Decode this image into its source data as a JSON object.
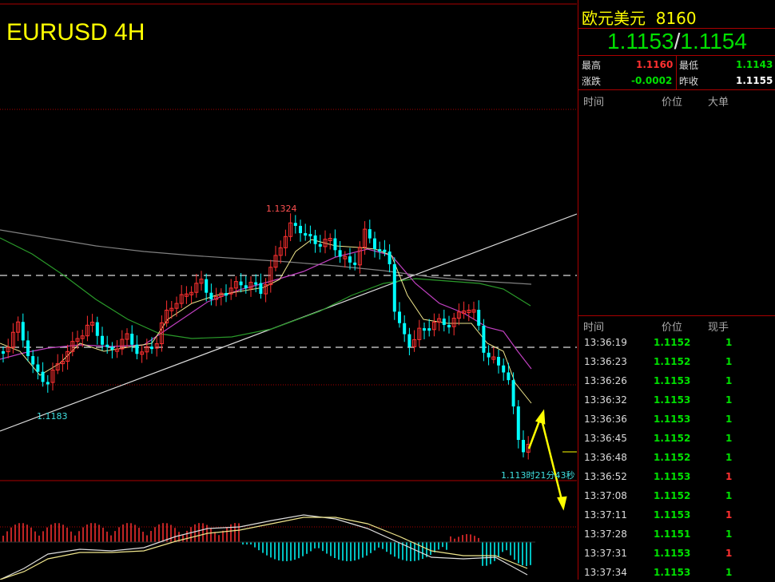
{
  "chart": {
    "symbol_title": "EURUSD 4H",
    "high_label": "1.1324",
    "low_label": "1.1183",
    "countdown_label": "1.113时21分43秒"
  },
  "quote": {
    "name": "欧元美元",
    "code": "8160",
    "bid": "1.1153",
    "separator": "/",
    "ask": "1.1154",
    "stats": {
      "high_label": "最高",
      "high_value": "1.1160",
      "low_label": "最低",
      "low_value": "1.1143",
      "change_label": "涨跌",
      "change_value": "-0.0002",
      "prev_close_label": "昨收",
      "prev_close_value": "1.1155"
    },
    "big_orders_header": {
      "time": "时间",
      "price": "价位",
      "big": "大单"
    },
    "ticks_header": {
      "time": "时间",
      "price": "价位",
      "volume": "现手"
    },
    "ticks": [
      {
        "time": "13:36:19",
        "price": "1.1152",
        "volume": "1",
        "up": true
      },
      {
        "time": "13:36:23",
        "price": "1.1152",
        "volume": "1",
        "up": true
      },
      {
        "time": "13:36:26",
        "price": "1.1153",
        "volume": "1",
        "up": true
      },
      {
        "time": "13:36:32",
        "price": "1.1153",
        "volume": "1",
        "up": true
      },
      {
        "time": "13:36:36",
        "price": "1.1153",
        "volume": "1",
        "up": true
      },
      {
        "time": "13:36:45",
        "price": "1.1152",
        "volume": "1",
        "up": true
      },
      {
        "time": "13:36:48",
        "price": "1.1152",
        "volume": "1",
        "up": true
      },
      {
        "time": "13:36:52",
        "price": "1.1153",
        "volume": "1",
        "up": false
      },
      {
        "time": "13:37:08",
        "price": "1.1152",
        "volume": "1",
        "up": true
      },
      {
        "time": "13:37:11",
        "price": "1.1153",
        "volume": "1",
        "up": false
      },
      {
        "time": "13:37:28",
        "price": "1.1151",
        "volume": "1",
        "up": true
      },
      {
        "time": "13:37:31",
        "price": "1.1153",
        "volume": "1",
        "up": false
      },
      {
        "time": "13:37:34",
        "price": "1.1153",
        "volume": "1",
        "up": true
      }
    ]
  },
  "colors": {
    "bull": "#ff3030",
    "bear": "#00ffff",
    "up_text": "#ff3030",
    "down_text": "#00e000",
    "title": "#ffff00",
    "grid_red": "#a00000"
  }
}
